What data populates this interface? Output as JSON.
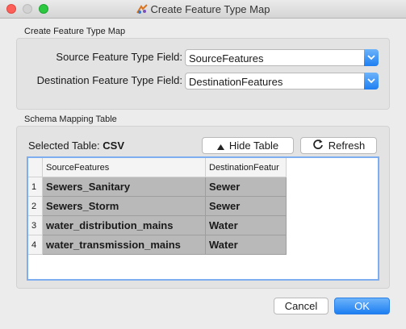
{
  "window": {
    "title": "Create Feature Type Map"
  },
  "feature_map_group": {
    "label": "Create Feature Type Map",
    "source_label": "Source Feature Type Field:",
    "source_value": "SourceFeatures",
    "dest_label": "Destination Feature Type Field:",
    "dest_value": "DestinationFeatures"
  },
  "schema_group": {
    "label": "Schema Mapping Table",
    "selected_prefix": "Selected Table:",
    "selected_value": "CSV",
    "hide_label": "Hide Table",
    "refresh_label": "Refresh"
  },
  "table": {
    "columns": [
      "SourceFeatures",
      "DestinationFeatur"
    ],
    "rows": [
      {
        "num": "1",
        "source": "Sewers_Sanitary",
        "dest": "Sewer"
      },
      {
        "num": "2",
        "source": "Sewers_Storm",
        "dest": "Sewer"
      },
      {
        "num": "3",
        "source": "water_distribution_mains",
        "dest": "Water"
      },
      {
        "num": "4",
        "source": "water_transmission_mains",
        "dest": "Water"
      }
    ]
  },
  "footer": {
    "cancel_label": "Cancel",
    "ok_label": "OK"
  },
  "colors": {
    "accent": "#1e7ff2",
    "selected_cell": "#b9b9b9",
    "window_bg": "#ececec"
  }
}
